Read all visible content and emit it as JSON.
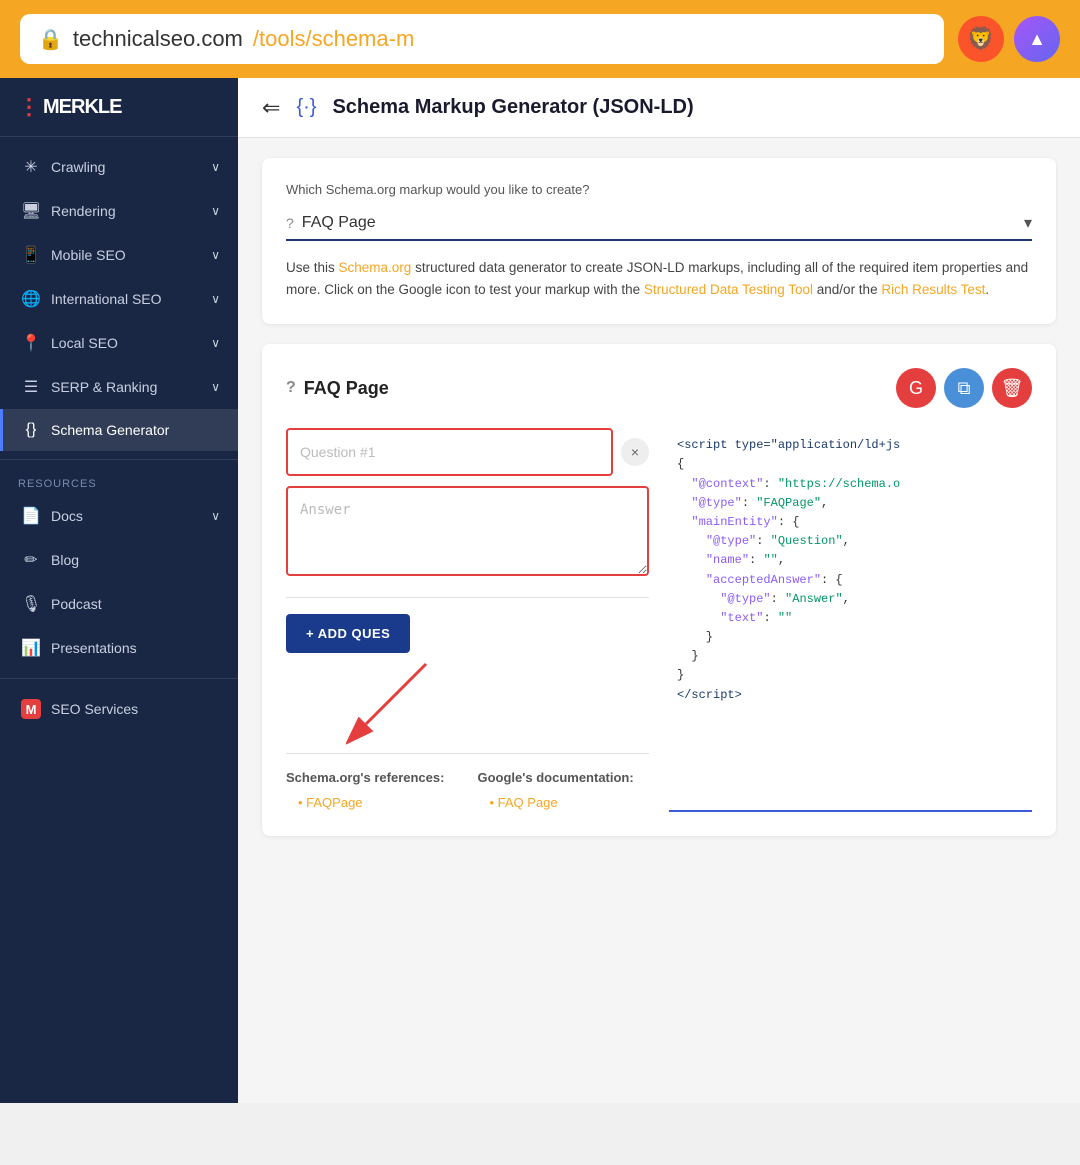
{
  "browser": {
    "address": "technicalseo.com/tools/schema-m",
    "url_domain": "technicalseo.com",
    "url_path": "/tools/schema-m",
    "lock_icon": "🔒",
    "brave_icon": "🦁",
    "prism_icon": "△"
  },
  "header": {
    "back_arrow": "⇐",
    "schema_icon": "{·}",
    "title": "Schema Markup Generator (JSON-LD)"
  },
  "sidebar": {
    "logo": "MERKLE",
    "nav_items": [
      {
        "id": "crawling",
        "icon": "✳",
        "label": "Crawling",
        "has_chevron": true
      },
      {
        "id": "rendering",
        "icon": "🖥",
        "label": "Rendering",
        "has_chevron": true
      },
      {
        "id": "mobile-seo",
        "icon": "📱",
        "label": "Mobile SEO",
        "has_chevron": true
      },
      {
        "id": "international-seo",
        "icon": "🌐",
        "label": "International SEO",
        "has_chevron": true
      },
      {
        "id": "local-seo",
        "icon": "📍",
        "label": "Local SEO",
        "has_chevron": true
      },
      {
        "id": "serp-ranking",
        "icon": "☰",
        "label": "SERP & Ranking",
        "has_chevron": true
      },
      {
        "id": "schema-generator",
        "icon": "{}",
        "label": "Schema Generator",
        "has_chevron": false,
        "active": true
      }
    ],
    "resources_label": "Resources",
    "resource_items": [
      {
        "id": "docs",
        "icon": "📄",
        "label": "Docs",
        "has_chevron": true
      },
      {
        "id": "blog",
        "icon": "✏",
        "label": "Blog",
        "has_chevron": false
      },
      {
        "id": "podcast",
        "icon": "🎙",
        "label": "Podcast",
        "has_chevron": false
      },
      {
        "id": "presentations",
        "icon": "📊",
        "label": "Presentations",
        "has_chevron": false
      }
    ],
    "seo_services": "SEO Services"
  },
  "schema_selector": {
    "question_label": "Which Schema.org markup would you like to create?",
    "selected_value": "FAQ Page",
    "selected_icon": "?",
    "description": "Use this Schema.org structured data generator to create JSON-LD markups, including all of the required item properties and more. Click on the Google icon to test your markup with the Structured Data Testing Tool and/or the Rich Results Test.",
    "schema_link": "Schema.org",
    "structured_data_link": "Structured Data Testing Tool",
    "rich_results_link": "Rich Results Test"
  },
  "faq_section": {
    "title": "FAQ Page",
    "title_icon": "?",
    "google_btn_label": "G",
    "copy_btn_icon": "⧉",
    "delete_btn_icon": "🗑",
    "question_placeholder": "Question #1",
    "answer_placeholder": "Answer",
    "close_btn": "×",
    "add_question_btn": "+ ADD QUES",
    "references": {
      "schema_label": "Schema.org's references:",
      "schema_links": [
        "FAQPage"
      ],
      "google_label": "Google's documentation:",
      "google_links": [
        "FAQ Page"
      ]
    },
    "json_code": "<script type=\"application/ld+js\"\n{\n  \"@context\": \"https://schema.o\n  \"@type\": \"FAQPage\",\n  \"mainEntity\": {\n    \"@type\": \"Question\",\n    \"name\": \"\",\n    \"acceptedAnswer\": {\n      \"@type\": \"Answer\",\n      \"text\": \"\"\n    }\n  }\n}\n</script>"
  }
}
